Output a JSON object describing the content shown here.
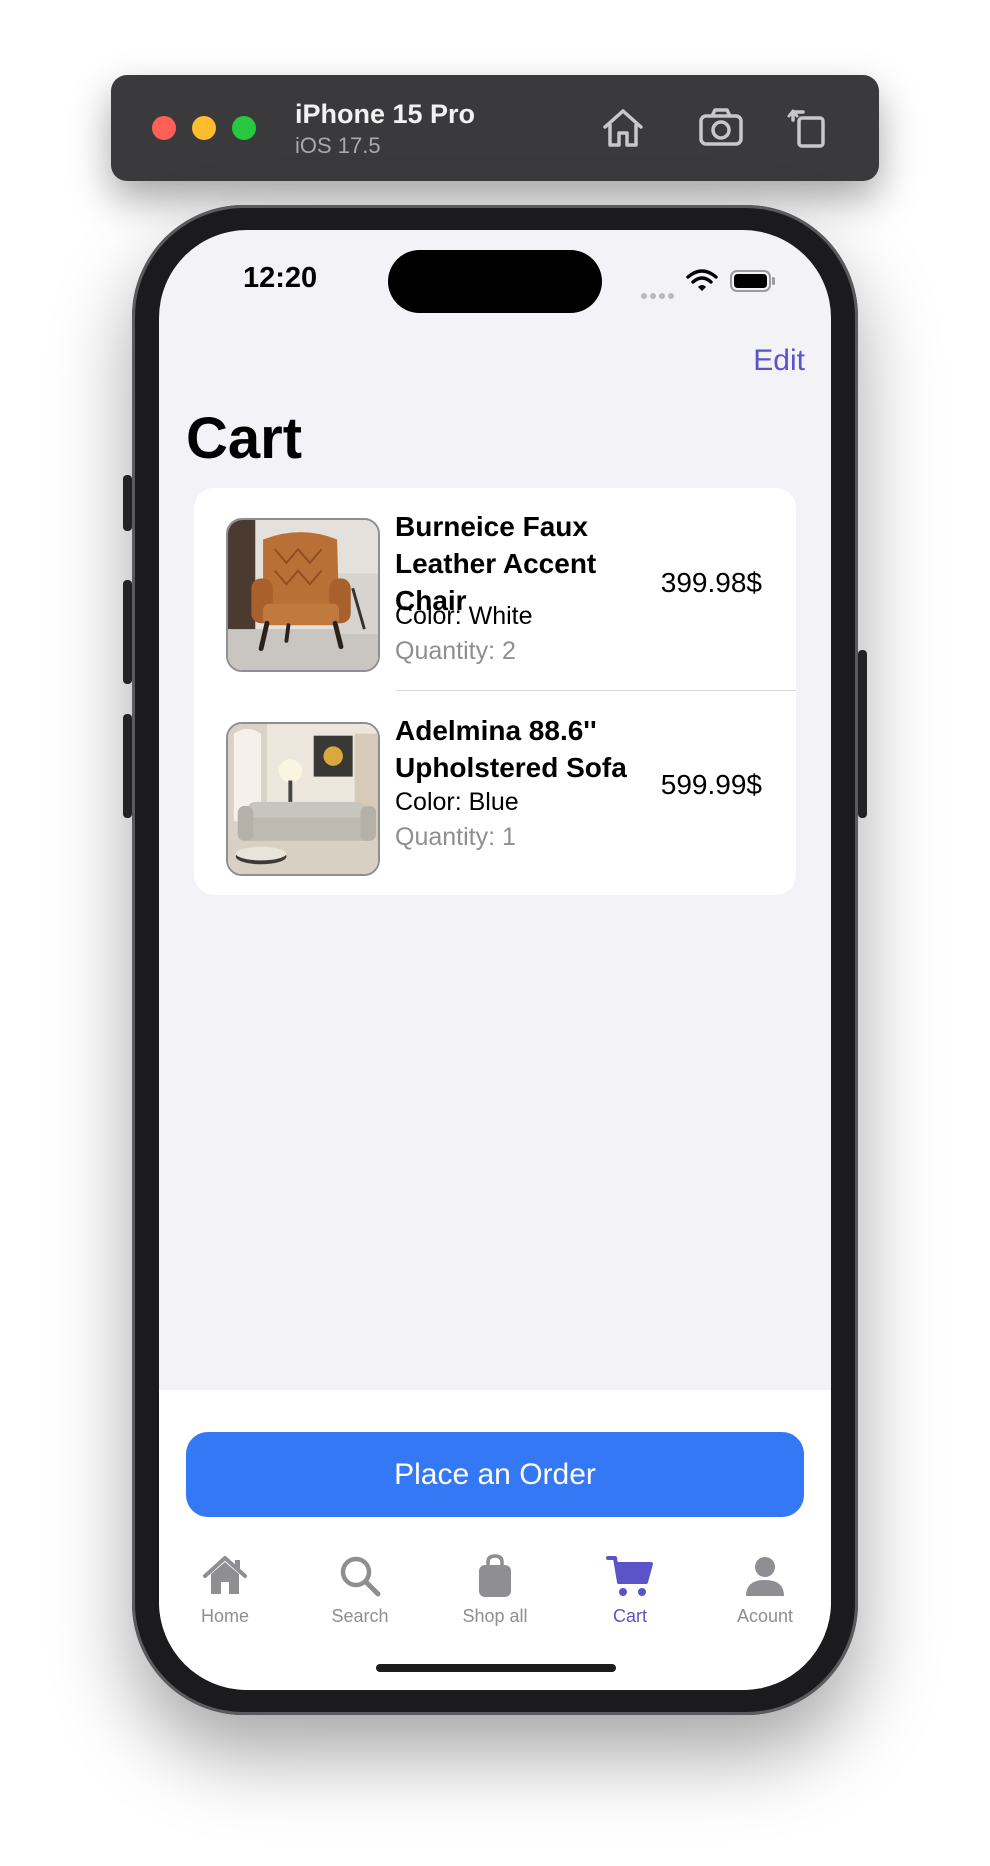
{
  "simulator": {
    "device_name": "iPhone 15 Pro",
    "os_version": "iOS 17.5"
  },
  "status_bar": {
    "time": "12:20"
  },
  "nav": {
    "edit_label": "Edit",
    "title": "Cart"
  },
  "cart": {
    "items": [
      {
        "name_lines": [
          "Burneice Faux",
          "Leather Accent",
          "Chair"
        ],
        "color": "Color: White",
        "quantity": "Quantity: 2",
        "price": "399.98$",
        "thumbnail": "leather-accent-chair-photo"
      },
      {
        "name_lines": [
          "Adelmina 88.6''",
          "Upholstered Sofa"
        ],
        "color": "Color: Blue",
        "quantity": "Quantity: 1",
        "price": "599.99$",
        "thumbnail": "upholstered-sofa-photo"
      }
    ]
  },
  "order_button": {
    "label": "Place an Order",
    "color": "#3478f6"
  },
  "tab_bar": {
    "accent": "#5a54c8",
    "inactive": "#8e8e93",
    "items": [
      {
        "label": "Home",
        "icon": "house-icon",
        "active": false
      },
      {
        "label": "Search",
        "icon": "magnifier-icon",
        "active": false
      },
      {
        "label": "Shop all",
        "icon": "bag-icon",
        "active": false
      },
      {
        "label": "Cart",
        "icon": "cart-icon",
        "active": true
      },
      {
        "label": "Acount",
        "icon": "person-icon",
        "active": false
      }
    ]
  }
}
